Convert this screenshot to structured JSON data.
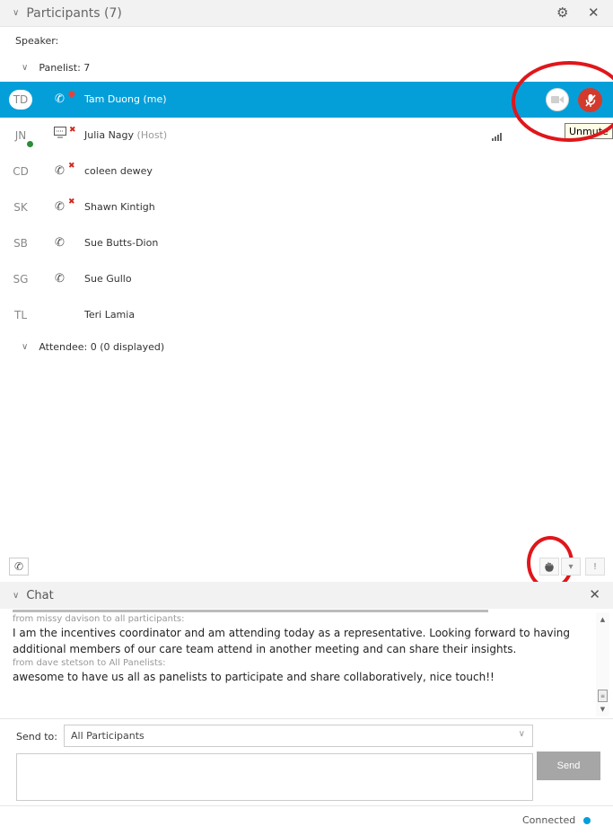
{
  "participants": {
    "title": "Participants (7)",
    "speaker_label": "Speaker:",
    "panelist_group": "Panelist: 7",
    "attendee_group": "Attendee: 0 (0 displayed)",
    "rows": [
      {
        "initials": "TD",
        "name": "Tam Duong (me)",
        "role": ""
      },
      {
        "initials": "JN",
        "name": "Julia Nagy",
        "role": "(Host)"
      },
      {
        "initials": "CD",
        "name": "coleen dewey",
        "role": ""
      },
      {
        "initials": "SK",
        "name": "Shawn Kintigh",
        "role": ""
      },
      {
        "initials": "SB",
        "name": "Sue Butts-Dion",
        "role": ""
      },
      {
        "initials": "SG",
        "name": "Sue Gullo",
        "role": ""
      },
      {
        "initials": "TL",
        "name": "Teri Lamia",
        "role": ""
      }
    ],
    "tooltip": "Unmute"
  },
  "icons": {
    "settings": "gear-icon",
    "close": "close-icon",
    "phone": "phone-icon",
    "screen": "screen-share-icon",
    "video": "video-camera-icon",
    "mute": "microphone-muted-icon",
    "raise_hand": "raise-hand-icon",
    "signal": "signal-bars-icon"
  },
  "chat": {
    "title": "Chat",
    "messages": [
      {
        "from": "from missy davison to all participants:",
        "body": "I am the incentives coordinator and am attending today as a representative.  Looking forward to having additional members of our care team attend in another meeting and can share their insights."
      },
      {
        "from": "from dave stetson to All Panelists:",
        "body": "awesome to have us all as panelists to participate and share collaboratively, nice touch!!"
      }
    ],
    "send_to_label": "Send to:",
    "send_to_value": "All Participants",
    "send_label": "Send",
    "input_value": ""
  },
  "status": {
    "text": "Connected"
  },
  "colors": {
    "selected_row": "#049fd9",
    "mute_red": "#d33a2c",
    "annotation_red": "#e0161b",
    "status_dot": "#049fd9"
  }
}
